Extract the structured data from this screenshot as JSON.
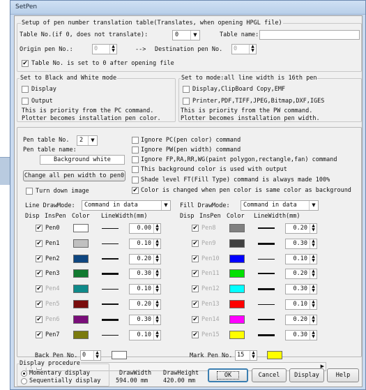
{
  "window": {
    "title": "SetPen"
  },
  "translation": {
    "legend": "Setup of pen number translation table(Translates, when opening HPGL file)",
    "table_no_label": "Table No.(if 0, does not translate):",
    "table_no_value": "0",
    "table_name_label": "Table name:",
    "table_name_value": "",
    "origin_label": "Origin pen No.:",
    "origin_value": "0",
    "arrow_label": "-->",
    "destination_label": "Destination pen No.",
    "destination_value": "0",
    "reset_label": "Table No. is set to 0 after opening file",
    "reset_checked": "✔"
  },
  "bw": {
    "legend": "Set to Black and White mode",
    "display_label": "Display",
    "output_label": "Output",
    "note1": "This is priority from the PC command.",
    "note2": "Plotter becomes installation pen color."
  },
  "linewidth": {
    "legend": "Set to mode:all line width is 16th pen",
    "display_label": "Display,ClipBoard Copy,EMF",
    "printer_label": "Printer,PDF,TIFF,JPEG,Bitmap,DXF,IGES",
    "note1": "This is priority from the PW command.",
    "note2": "Plotter becomes installation pen width."
  },
  "pentable": {
    "no_label": "Pen table No.",
    "no_value": "2",
    "name_label": "Pen table name:",
    "name_value": "Background white",
    "change_button": "Change all pen width to pen0",
    "turn_down_label": "Turn down image"
  },
  "options": [
    {
      "label": "Ignore PC(pen color) command",
      "checked": ""
    },
    {
      "label": "Ignore PW(pen width) command",
      "checked": ""
    },
    {
      "label": "Ignore FP,RA,RR,WG(paint polygon,rectangle,fan) command",
      "checked": ""
    },
    {
      "label": "This background color is used with output",
      "checked": ""
    },
    {
      "label": "Shade level FT(Fill Type) command is always made 100%",
      "checked": ""
    },
    {
      "label": "Color is changed when pen color is same color as background",
      "checked": "✔"
    }
  ],
  "line_draw": {
    "label": "Line DrawMode:",
    "value": "Command in data",
    "headers": {
      "disp": "Disp",
      "inspen": "InsPen",
      "color": "Color",
      "width": "LineWidth(mm)"
    },
    "pens": [
      {
        "name": "Pen0",
        "check": "✔",
        "color": "#ffffff",
        "width": "0.00",
        "disabled": false
      },
      {
        "name": "Pen1",
        "check": "✔",
        "color": "#c0c0c0",
        "width": "0.10",
        "disabled": false
      },
      {
        "name": "Pen2",
        "check": "✔",
        "color": "#0e4680",
        "width": "0.20",
        "disabled": false
      },
      {
        "name": "Pen3",
        "check": "✔",
        "color": "#127a30",
        "width": "0.30",
        "disabled": false
      },
      {
        "name": "Pen4",
        "check": "✔",
        "color": "#0f8a8a",
        "width": "0.10",
        "disabled": true
      },
      {
        "name": "Pen5",
        "check": "✔",
        "color": "#7a0e0e",
        "width": "0.20",
        "disabled": true
      },
      {
        "name": "Pen6",
        "check": "✔",
        "color": "#7a0e7a",
        "width": "0.30",
        "disabled": true
      },
      {
        "name": "Pen7",
        "check": "✔",
        "color": "#7a7a0e",
        "width": "0.10",
        "disabled": false
      }
    ],
    "back_pen_label": "Back Pen No.",
    "back_pen_value": "0",
    "back_pen_color": "#ffffff"
  },
  "fill_draw": {
    "label": "Fill DrawMode:",
    "value": "Command in data",
    "headers": {
      "disp": "Disp",
      "inspen": "InsPen",
      "color": "Color",
      "width": "LineWidth(mm)"
    },
    "pens": [
      {
        "name": "Pen8",
        "check": "✔",
        "color": "#808080",
        "width": "0.20",
        "disabled": true
      },
      {
        "name": "Pen9",
        "check": "✔",
        "color": "#404040",
        "width": "0.30",
        "disabled": true
      },
      {
        "name": "Pen10",
        "check": "✔",
        "color": "#0000ff",
        "width": "0.10",
        "disabled": true
      },
      {
        "name": "Pen11",
        "check": "✔",
        "color": "#00e000",
        "width": "0.20",
        "disabled": true
      },
      {
        "name": "Pen12",
        "check": "✔",
        "color": "#00ffff",
        "width": "0.30",
        "disabled": true
      },
      {
        "name": "Pen13",
        "check": "✔",
        "color": "#ff0000",
        "width": "0.10",
        "disabled": true
      },
      {
        "name": "Pen14",
        "check": "✔",
        "color": "#ff00ff",
        "width": "0.20",
        "disabled": true
      },
      {
        "name": "Pen15",
        "check": "✔",
        "color": "#ffff00",
        "width": "0.30",
        "disabled": true
      }
    ],
    "mark_pen_label": "Mark Pen No.",
    "mark_pen_value": "15",
    "mark_pen_color": "#ffff00"
  },
  "bottom": {
    "procedure_legend": "Display procedure",
    "momentary_label": "Momentary display",
    "sequential_label": "Sequentially display",
    "draw_width_label": "DrawWidth",
    "draw_width_value": "594.00 mm",
    "draw_height_label": "DrawHeight",
    "draw_height_value": "420.00 mm",
    "ok_label": "OK",
    "cancel_label": "Cancel",
    "display_label": "Display",
    "help_label": "Help"
  },
  "icons": {
    "arrow_down": "▼",
    "arrow_up": "▲",
    "arrow_left": "◀",
    "arrow_right": "▶",
    "check": "✔"
  }
}
